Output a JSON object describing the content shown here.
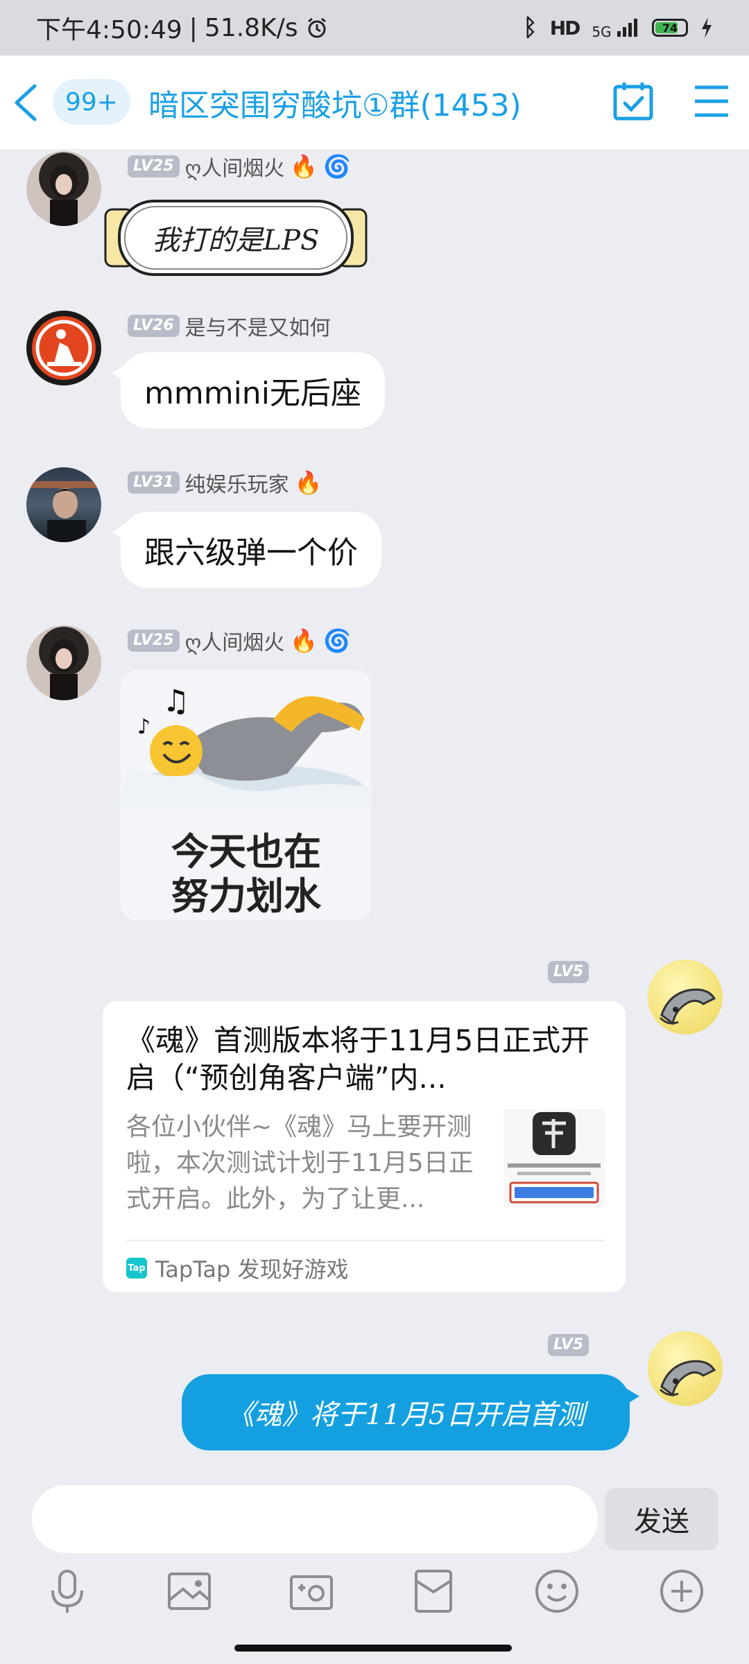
{
  "status_bar": {
    "time": "下午4:50:49",
    "separator": "|",
    "speed": "51.8K/s",
    "network": "5G",
    "battery": "74"
  },
  "header": {
    "unread": "99+",
    "title": "暗区突围穷酸坑①群(1453)"
  },
  "messages": [
    {
      "level": "LV25",
      "name": "ღ人间烟火",
      "text": "我打的是LPS"
    },
    {
      "level": "LV26",
      "name": "是与不是又如何",
      "text": "mmmini无后座"
    },
    {
      "level": "LV31",
      "name": "纯娱乐玩家",
      "text": "跟六级弹一个价"
    },
    {
      "level": "LV25",
      "name": "ღ人间烟火",
      "sticker_line1": "今天也在",
      "sticker_line2": "努力划水"
    }
  ],
  "link_card": {
    "level": "LV5",
    "title": "《魂》首测版本将于11月5日正式开启（“预创角客户端”内...",
    "description": "各位小伙伴~《魂》马上要开测啦，本次测试计划于11月5日正式开启。此外，为了让更...",
    "source": "TapTap 发现好游戏",
    "tap_logo": "Tap"
  },
  "outgoing": {
    "level": "LV5",
    "text": "《魂》将于11月5日开启首测"
  },
  "input": {
    "send_label": "发送"
  },
  "colors": {
    "accent": "#1aa0e6",
    "background": "#ebedf2",
    "outgoing_bubble": "#14a0e0"
  },
  "icons": [
    "back-icon",
    "calendar-check-icon",
    "menu-icon",
    "microphone-icon",
    "image-icon",
    "camera-icon",
    "red-packet-icon",
    "emoji-icon",
    "plus-icon"
  ]
}
